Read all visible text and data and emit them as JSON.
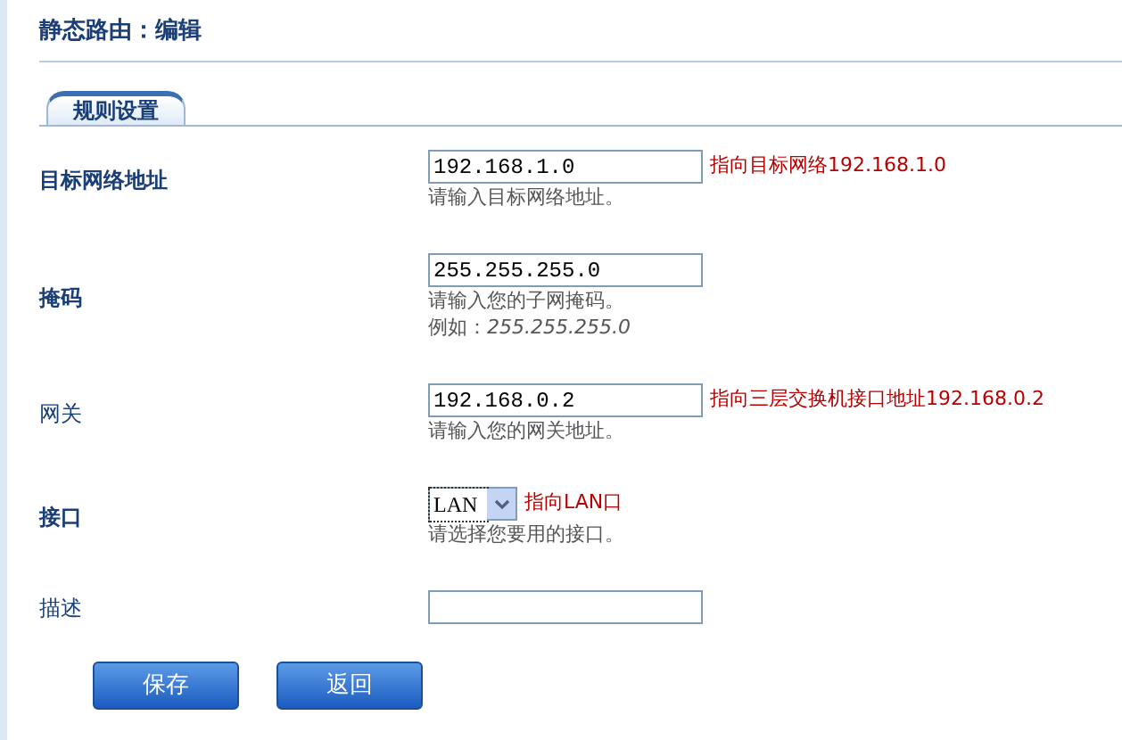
{
  "page_title": "静态路由：编辑",
  "tabs": [
    {
      "label": "规则设置",
      "selected": true
    }
  ],
  "fields": [
    {
      "label": "目标网络地址",
      "emphasized": true,
      "kind": "text",
      "value": "192.168.1.0",
      "note": "指向目标网络192.168.1.0",
      "hints": [
        "请输入目标网络地址。"
      ]
    },
    {
      "label": "掩码",
      "emphasized": true,
      "kind": "text",
      "value": "255.255.255.0",
      "hints": [
        "请输入您的子网掩码。",
        "例如：*255.255.255.0*"
      ]
    },
    {
      "label": "网关",
      "emphasized": false,
      "kind": "text",
      "value": "192.168.0.2",
      "note": "指向三层交换机接口地址192.168.0.2",
      "hints": [
        "请输入您的网关地址。"
      ]
    },
    {
      "label": "接口",
      "emphasized": true,
      "kind": "select",
      "value": "LAN",
      "note": "指向LAN口",
      "hints": [
        "请选择您要用的接口。"
      ]
    },
    {
      "label": "描述",
      "emphasized": false,
      "kind": "text"
    }
  ],
  "buttons": [
    "保存",
    "返回"
  ]
}
